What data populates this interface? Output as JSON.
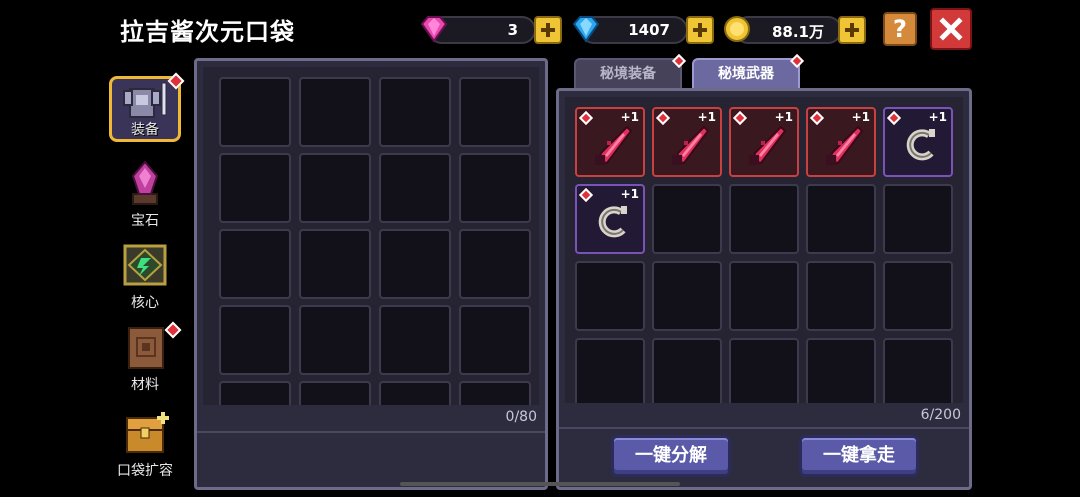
{
  "header": {
    "title": "拉吉酱次元口袋",
    "gems": "3",
    "diamonds": "1407",
    "coins": "88.1万",
    "help_label": "?"
  },
  "sidebar": {
    "items": [
      {
        "label": "装备",
        "icon": "armor-icon",
        "active": true,
        "dot": true
      },
      {
        "label": "宝石",
        "icon": "gem-icon",
        "active": false,
        "dot": false
      },
      {
        "label": "核心",
        "icon": "core-icon",
        "active": false,
        "dot": false
      },
      {
        "label": "材料",
        "icon": "material-icon",
        "active": false,
        "dot": true
      },
      {
        "label": "口袋扩容",
        "icon": "chest-icon",
        "active": false,
        "dot": false
      }
    ]
  },
  "left_panel": {
    "count": "0/80"
  },
  "right_panel": {
    "tabs": [
      {
        "label": "秘境装备",
        "active": false
      },
      {
        "label": "秘境武器",
        "active": true
      }
    ],
    "items": [
      {
        "kind": "red-blade",
        "level": "+1"
      },
      {
        "kind": "red-blade",
        "level": "+1"
      },
      {
        "kind": "red-blade",
        "level": "+1"
      },
      {
        "kind": "red-blade",
        "level": "+1"
      },
      {
        "kind": "hook",
        "level": "+1"
      },
      {
        "kind": "hook",
        "level": "+1"
      }
    ],
    "count": "6/200",
    "decompose_label": "一键分解",
    "take_all_label": "一键拿走"
  },
  "colors": {
    "panel_bg": "#2d2b3e",
    "rarity_red": "#c84040",
    "rarity_purple": "#7a52b8",
    "button_blue": "#5a5aa8",
    "close_red": "#d23a3a",
    "plus_yellow": "#f0c535"
  }
}
